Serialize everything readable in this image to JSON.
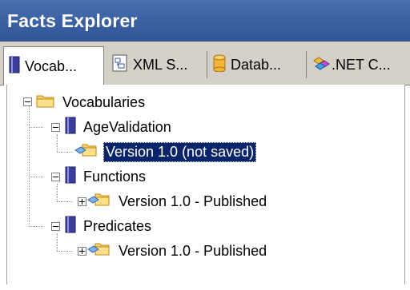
{
  "title": "Facts Explorer",
  "tabs": [
    {
      "label": "Vocab...",
      "icon": "vocabulary-book-icon",
      "active": true
    },
    {
      "label": "XML S...",
      "icon": "xml-schema-icon",
      "active": false
    },
    {
      "label": "Datab...",
      "icon": "database-cylinder-icon",
      "active": false
    },
    {
      "label": ".NET C...",
      "icon": "net-class-icon",
      "active": false
    }
  ],
  "tree": {
    "root": {
      "label": "Vocabularies",
      "icon": "folder-icon",
      "expanded": true
    },
    "vocabularies": [
      {
        "label": "AgeValidation",
        "icon": "vocabulary-book-icon",
        "expanded": true,
        "versions": [
          {
            "label": "Version 1.0 (not saved)",
            "selected": true,
            "icon": "version-icon"
          }
        ]
      },
      {
        "label": "Functions",
        "icon": "vocabulary-book-icon",
        "expanded": true,
        "versions": [
          {
            "label": "Version 1.0 - Published",
            "selected": false,
            "icon": "version-icon",
            "collapsed": true
          }
        ]
      },
      {
        "label": "Predicates",
        "icon": "vocabulary-book-icon",
        "expanded": true,
        "versions": [
          {
            "label": "Version 1.0 - Published",
            "selected": false,
            "icon": "version-icon",
            "collapsed": true
          }
        ]
      }
    ]
  }
}
